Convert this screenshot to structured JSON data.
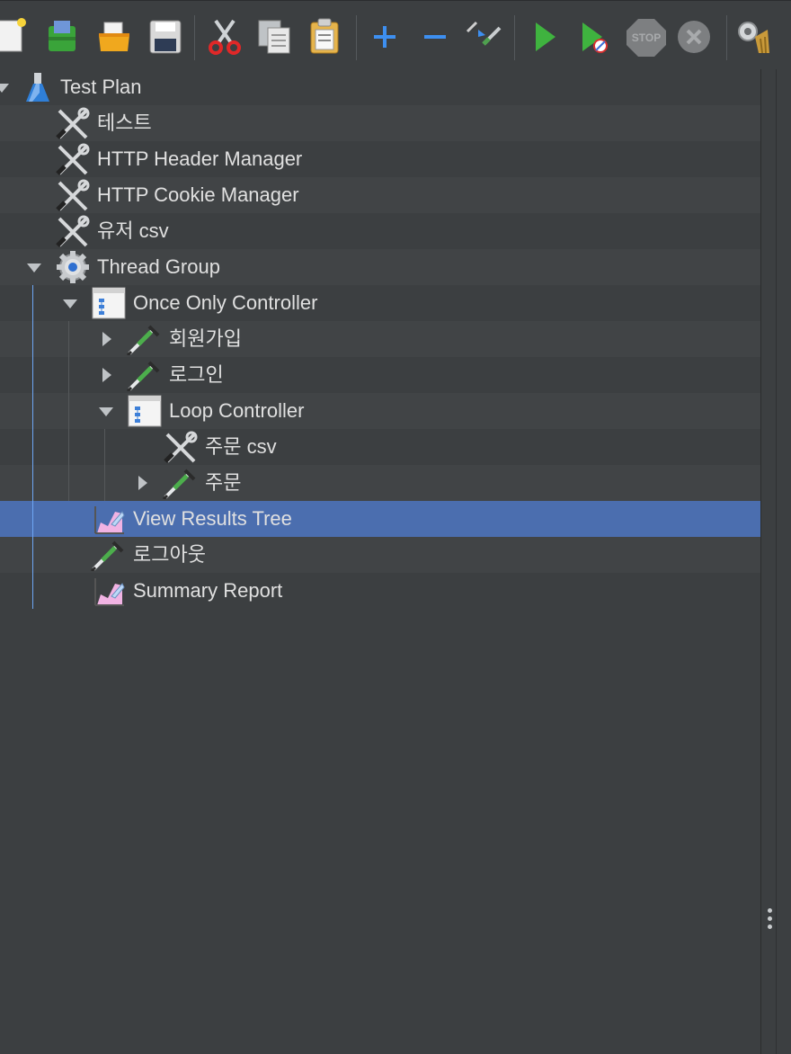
{
  "toolbar": {
    "buttons": [
      {
        "name": "new-icon"
      },
      {
        "name": "templates-icon"
      },
      {
        "name": "open-icon"
      },
      {
        "name": "save-icon"
      },
      {
        "name": "cut-icon"
      },
      {
        "name": "copy-icon"
      },
      {
        "name": "paste-icon"
      },
      {
        "name": "expand-icon"
      },
      {
        "name": "collapse-icon"
      },
      {
        "name": "toggle-icon"
      },
      {
        "name": "start-icon"
      },
      {
        "name": "start-no-pauses-icon"
      },
      {
        "name": "stop-icon",
        "label": "STOP"
      },
      {
        "name": "shutdown-icon"
      },
      {
        "name": "clear-icon"
      }
    ]
  },
  "tree": {
    "items": [
      {
        "label": "Test Plan",
        "icon": "flask-icon",
        "toggle": "down"
      },
      {
        "label": "테스트",
        "icon": "config-element-icon"
      },
      {
        "label": "HTTP Header Manager",
        "icon": "config-element-icon"
      },
      {
        "label": "HTTP Cookie Manager",
        "icon": "config-element-icon"
      },
      {
        "label": "유저 csv",
        "icon": "config-element-icon"
      },
      {
        "label": "Thread Group",
        "icon": "thread-group-gear-icon",
        "toggle": "down"
      },
      {
        "label": "Once Only Controller",
        "icon": "logic-controller-icon",
        "toggle": "down"
      },
      {
        "label": "회원가입",
        "icon": "sampler-pipette-icon",
        "toggle": "right"
      },
      {
        "label": "로그인",
        "icon": "sampler-pipette-icon",
        "toggle": "right"
      },
      {
        "label": "Loop Controller",
        "icon": "logic-controller-icon",
        "toggle": "down"
      },
      {
        "label": "주문 csv",
        "icon": "config-element-icon"
      },
      {
        "label": "주문",
        "icon": "sampler-pipette-icon",
        "toggle": "right"
      },
      {
        "label": "View Results Tree",
        "icon": "listener-chart-icon",
        "selected": true
      },
      {
        "label": "로그아웃",
        "icon": "sampler-pipette-icon"
      },
      {
        "label": "Summary Report",
        "icon": "listener-chart-icon"
      }
    ]
  },
  "colors": {
    "background": "#3c3f41",
    "selection": "#4b6eaf",
    "text": "#e0e0e0",
    "tree_line": "#6ea6f3"
  }
}
